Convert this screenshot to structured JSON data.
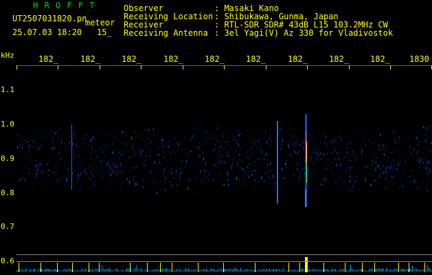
{
  "header": {
    "brand": "H R O F F T",
    "filename": "UT2507031820.pn",
    "mode": "meteor",
    "datetime": "25.07.03 18:20",
    "interval": "15_",
    "fields": [
      {
        "label": "Observer",
        "value": ": Masaki Kano"
      },
      {
        "label": "Receiving Location",
        "value": ": Shibukawa, Gunma, Japan"
      },
      {
        "label": "Receiver",
        "value": ": RTL-SDR SDR# 43dB L15 103.2MHz CW"
      },
      {
        "label": "Receiving Antenna",
        "value": ": 3el Yagi(V) Az 330 for Vladivostok"
      }
    ]
  },
  "time_axis": {
    "labels": [
      "182_",
      "182_",
      "182_",
      "182_",
      "182_",
      "182_",
      "182_",
      "182_",
      "182_",
      "1830"
    ]
  },
  "y_axis": {
    "unit": "kHz",
    "labels": [
      "1.1",
      "1.0",
      "0.9",
      "0.8",
      "0.7",
      "0.6"
    ]
  },
  "colors": {
    "text": "#ffff00",
    "brand": "#00d000",
    "background": "#000000"
  }
}
